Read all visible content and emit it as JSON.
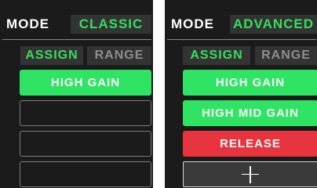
{
  "left_panel": {
    "mode_label": "MODE",
    "mode_value": "CLASSIC",
    "tabs": [
      {
        "label": "ASSIGN",
        "active": true
      },
      {
        "label": "RANGE",
        "active": false
      }
    ],
    "slots": [
      {
        "label": "HIGH GAIN",
        "state": "assigned",
        "color": "#2ee462"
      },
      {
        "label": "",
        "state": "empty"
      },
      {
        "label": "",
        "state": "empty"
      },
      {
        "label": "",
        "state": "empty"
      }
    ]
  },
  "right_panel": {
    "mode_label": "MODE",
    "mode_value": "ADVANCED",
    "tabs": [
      {
        "label": "ASSIGN",
        "active": true
      },
      {
        "label": "RANGE",
        "active": false
      }
    ],
    "slots": [
      {
        "label": "HIGH GAIN",
        "state": "assigned",
        "color": "#2ee462"
      },
      {
        "label": "HIGH MID GAIN",
        "state": "assigned",
        "color": "#2ee462"
      },
      {
        "label": "RELEASE",
        "state": "assigned",
        "color": "#e8343f"
      },
      {
        "label": "",
        "state": "add",
        "icon": "plus-icon"
      }
    ]
  },
  "colors": {
    "background": "#1b1b1b",
    "accent_green": "#35e05c",
    "tab_background": "#333333",
    "inactive_text": "#8e8e8e",
    "release_red": "#e8343f"
  }
}
